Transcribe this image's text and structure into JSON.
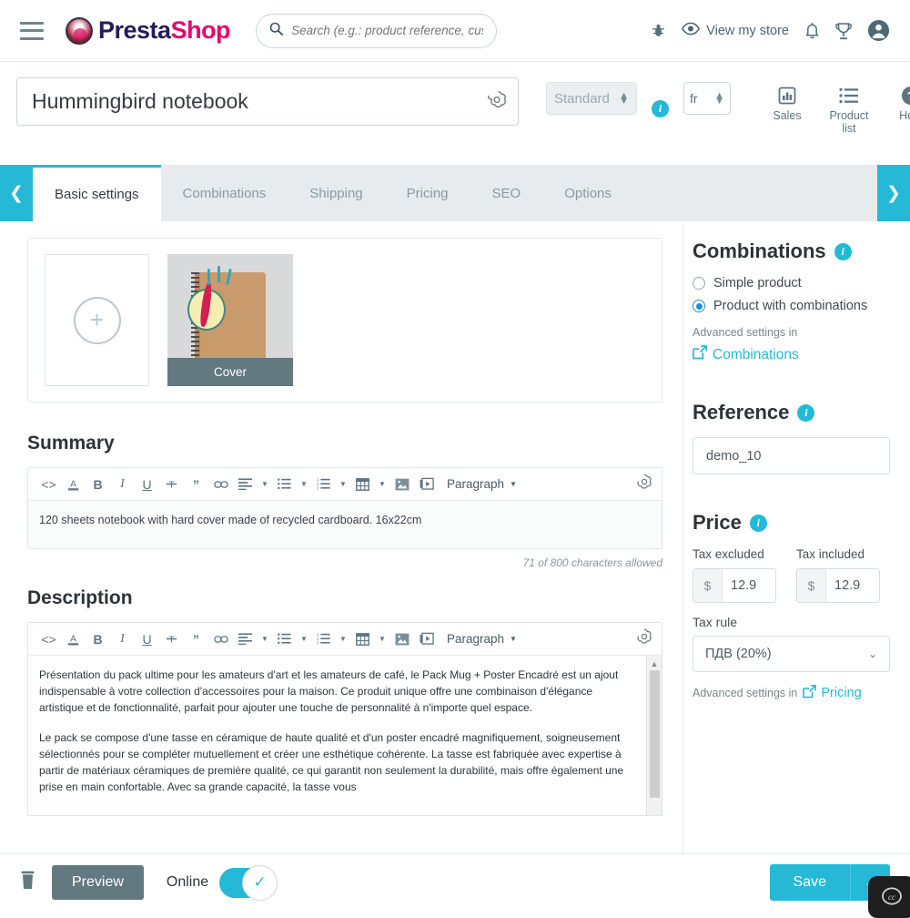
{
  "topnav": {
    "menu_icon": "hamburger-menu-icon",
    "brand_part1": "Presta",
    "brand_part2": "Shop",
    "search_placeholder": "Search (e.g.: product reference, custon",
    "search_value": "",
    "debug_icon": "bug-icon",
    "view_store_label": "View my store",
    "view_store_icon": "eye-icon",
    "notifications_icon": "bell-icon",
    "trophy_icon": "trophy-icon",
    "account_icon": "user-avatar-icon"
  },
  "product_header": {
    "title_value": "Hummingbird notebook",
    "ai_icon": "openai-sparkle-icon",
    "product_type": "Standard",
    "product_type_info": "i",
    "language": "fr",
    "tools": [
      {
        "label": "Sales",
        "icon": "bar-chart-icon"
      },
      {
        "label": "Product list",
        "icon": "list-icon"
      },
      {
        "label": "Help",
        "icon": "question-mark-circle-icon"
      }
    ]
  },
  "tabs": {
    "prev_icon": "chevron-left-icon",
    "next_icon": "chevron-right-icon",
    "items": [
      {
        "label": "Basic settings",
        "active": true
      },
      {
        "label": "Combinations",
        "active": false
      },
      {
        "label": "Shipping",
        "active": false
      },
      {
        "label": "Pricing",
        "active": false
      },
      {
        "label": "SEO",
        "active": false
      },
      {
        "label": "Options",
        "active": false
      }
    ]
  },
  "images": {
    "add_icon": "plus-circle-icon",
    "cover_label": "Cover"
  },
  "summary": {
    "heading": "Summary",
    "toolbar": {
      "source_code": "code-icon",
      "text_color": "text-color-icon",
      "bold": "B",
      "italic": "I",
      "underline": "U",
      "strikethrough": "strikethrough-icon",
      "quote": "quote-icon",
      "link": "link-icon",
      "align": "align-left-icon",
      "bullet_list": "bullet-list-icon",
      "numbered_list": "numbered-list-icon",
      "table": "table-icon",
      "image": "image-icon",
      "video": "video-icon",
      "format_label": "Paragraph",
      "ai": "openai-sparkle-icon"
    },
    "body": "120 sheets notebook with hard cover made of recycled cardboard. 16x22cm",
    "char_count": "71 of 800 characters allowed"
  },
  "description": {
    "heading": "Description",
    "paragraphs": [
      "Présentation du pack ultime pour les amateurs d'art et les amateurs de café, le Pack Mug + Poster Encadré est un ajout indispensable à votre collection d'accessoires pour la maison. Ce produit unique offre une combinaison d'élégance artistique et de fonctionnalité, parfait pour ajouter une touche de personnalité à n'importe quel espace.",
      "Le pack se compose d'une tasse en céramique de haute qualité et d'un poster encadré magnifiquement, soigneusement sélectionnés pour se compléter mutuellement et créer une esthétique cohérente. La tasse est fabriquée avec expertise à partir de matériaux céramiques de première qualité, ce qui garantit non seulement la durabilité, mais offre également une prise en main confortable. Avec sa grande capacité, la tasse vous"
    ]
  },
  "combinations": {
    "heading": "Combinations",
    "info_icon": "i",
    "option_simple": "Simple product",
    "option_combinations": "Product with combinations",
    "selected": "Product with combinations",
    "advanced_label": "Advanced settings in",
    "advanced_link": "Combinations",
    "external_icon": "external-link-icon"
  },
  "reference": {
    "heading": "Reference",
    "info_icon": "i",
    "value": "demo_10"
  },
  "price": {
    "heading": "Price",
    "info_icon": "i",
    "tax_excluded_label": "Tax excluded",
    "tax_excluded_currency": "$",
    "tax_excluded_value": "12.9",
    "tax_included_label": "Tax included",
    "tax_included_currency": "$",
    "tax_included_value": "12.9",
    "tax_rule_label": "Tax rule",
    "tax_rule_value": "ПДВ (20%)",
    "advanced_label": "Advanced settings in",
    "advanced_link": "Pricing",
    "external_icon": "external-link-icon",
    "chevron_icon": "chevron-down-icon"
  },
  "footer": {
    "delete_icon": "trash-icon",
    "preview_label": "Preview",
    "online_label": "Online",
    "online_state": true,
    "check_icon": "check-icon",
    "save_label": "Save",
    "save_dropdown_icon": "chevron-down-icon",
    "chat_icon": "chat-widget-icon"
  },
  "colors": {
    "accent": "#25b9d7",
    "brand_dark": "#251c5c",
    "brand_pink": "#e6006e",
    "slate": "#61797f",
    "tab_bg": "#e7ebee"
  }
}
